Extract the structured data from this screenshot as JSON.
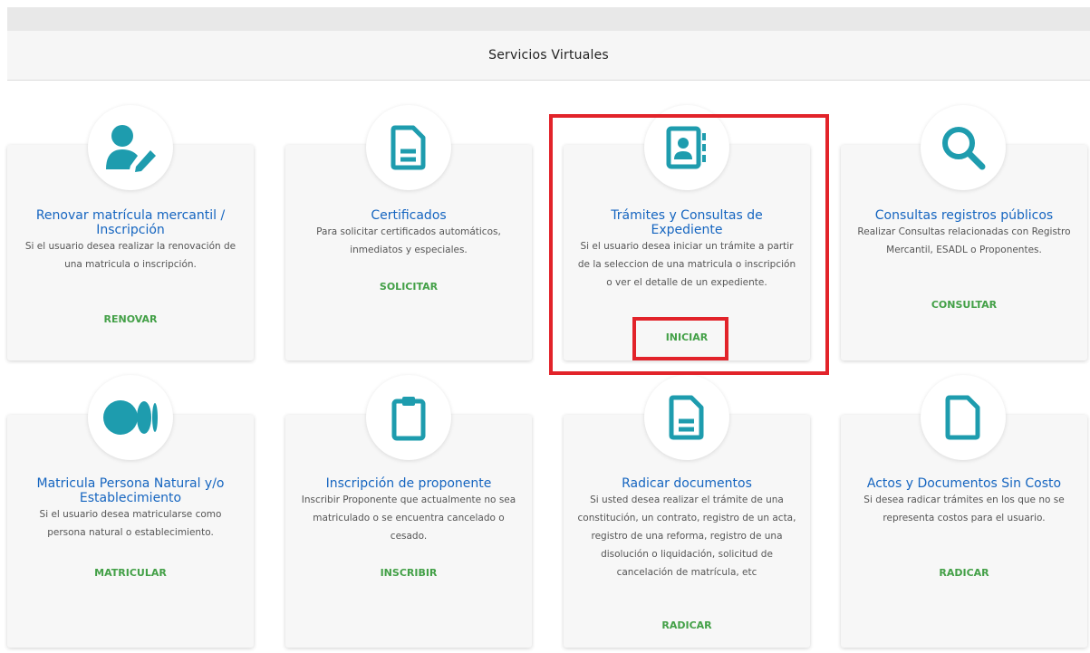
{
  "header": {
    "title": "Servicios Virtuales"
  },
  "colors": {
    "icon": "#1e9cae",
    "title": "#1565c0",
    "action": "#43a047",
    "highlight": "#e2232a"
  },
  "cards": [
    {
      "icon": "user-edit-icon",
      "title": "Renovar matrícula mercantil / Inscripción",
      "description": "Si el usuario desea realizar la renovación de una matricula o inscripción.",
      "action": "RENOVAR"
    },
    {
      "icon": "document-icon",
      "title": "Certificados",
      "description": "Para solicitar certificados automáticos, inmediatos y especiales.",
      "action": "SOLICITAR"
    },
    {
      "icon": "address-book-icon",
      "title": "Trámites y Consultas de Expediente",
      "description": "Si el usuario desea iniciar un trámite a partir de la seleccion de una matricula o inscripción o ver el detalle de un expediente.",
      "action": "INICIAR"
    },
    {
      "icon": "search-icon",
      "title": "Consultas registros públicos",
      "description": "Realizar Consultas relacionadas con Registro Mercantil, ESADL o Proponentes.",
      "action": "CONSULTAR"
    },
    {
      "icon": "medium-icon",
      "title": "Matricula Persona Natural y/o Establecimiento",
      "description": "Si el usuario desea matricularse como persona natural o establecimiento.",
      "action": "MATRICULAR"
    },
    {
      "icon": "clipboard-icon",
      "title": "Inscripción de proponente",
      "description": "Inscribir Proponente que actualmente no sea matriculado o se encuentra cancelado o cesado.",
      "action": "INSCRIBIR"
    },
    {
      "icon": "document-icon",
      "title": "Radicar documentos",
      "description": "Si usted desea realizar el trámite de una constitución, un contrato, registro de un acta, registro de una reforma, registro de una disolución o liquidación, solicitud de cancelación de matrícula, etc",
      "action": "RADICAR"
    },
    {
      "icon": "file-icon",
      "title": "Actos y Documentos Sin Costo",
      "description": "Si desea radicar trámites en los que no se representa costos para el usuario.",
      "action": "RADICAR"
    }
  ]
}
